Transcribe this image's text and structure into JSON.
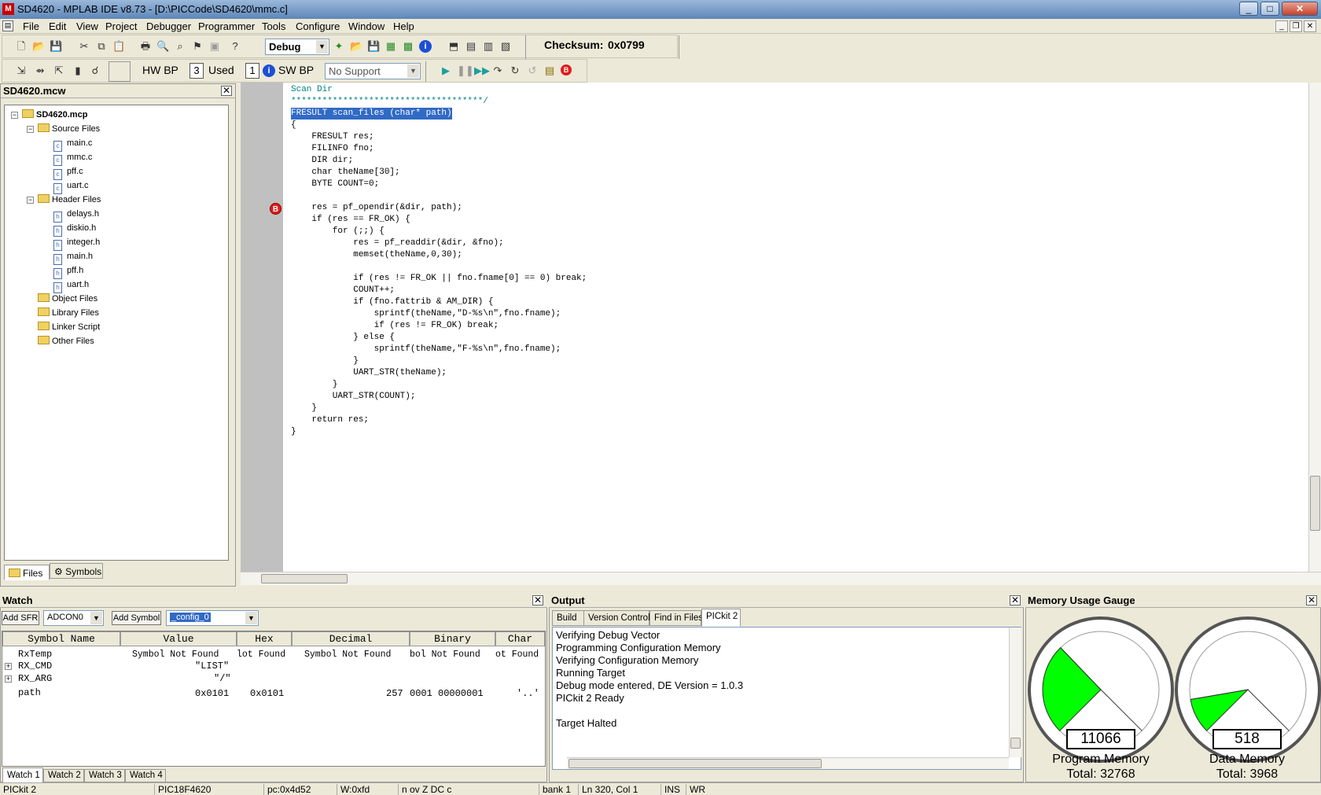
{
  "window": {
    "title": "SD4620 - MPLAB IDE v8.73 - [D:\\PICCode\\SD4620\\mmc.c]"
  },
  "menu": [
    "File",
    "Edit",
    "View",
    "Project",
    "Debugger",
    "Programmer",
    "Tools",
    "Configure",
    "Window",
    "Help"
  ],
  "toolbar": {
    "build_config": "Debug",
    "checksum_label": "Checksum:",
    "checksum_value": "0x0799",
    "hw_bp_label": "HW BP",
    "hw_bp_count": "3",
    "used_label": "Used",
    "used_count": "1",
    "sw_bp_label": "SW BP",
    "sw_bp_select": "No Support"
  },
  "project": {
    "title": "SD4620.mcw",
    "root": "SD4620.mcp",
    "folders": [
      {
        "name": "Source Files",
        "files": [
          "main.c",
          "mmc.c",
          "pff.c",
          "uart.c"
        ]
      },
      {
        "name": "Header Files",
        "files": [
          "delays.h",
          "diskio.h",
          "integer.h",
          "main.h",
          "pff.h",
          "uart.h"
        ]
      },
      {
        "name": "Object Files",
        "files": []
      },
      {
        "name": "Library Files",
        "files": []
      },
      {
        "name": "Linker Script",
        "files": []
      },
      {
        "name": "Other Files",
        "files": []
      }
    ],
    "tabs": [
      "Files",
      "Symbols"
    ]
  },
  "editor": {
    "lines": [
      "Scan Dir",
      "*************************************/",
      "FRESULT scan_files (char* path)",
      "{",
      "    FRESULT res;",
      "    FILINFO fno;",
      "    DIR dir;",
      "    char theName[30];",
      "    BYTE COUNT=0;",
      "",
      "    res = pf_opendir(&dir, path);",
      "    if (res == FR_OK) {",
      "        for (;;) {",
      "            res = pf_readdir(&dir, &fno);",
      "            memset(theName,0,30);",
      "",
      "            if (res != FR_OK || fno.fname[0] == 0) break;",
      "            COUNT++;",
      "            if (fno.fattrib & AM_DIR) {",
      "                sprintf(theName,\"D-%s\\n\",fno.fname);",
      "                if (res != FR_OK) break;",
      "            } else {",
      "                sprintf(theName,\"F-%s\\n\",fno.fname);",
      "            }",
      "            UART_STR(theName);",
      "        }",
      "        UART_STR(COUNT);",
      "    }",
      "    return res;",
      "}"
    ],
    "breakpoint_glyph": "B"
  },
  "watch": {
    "title": "Watch",
    "add_sfr": "Add SFR",
    "sfr_select": "ADCON0",
    "add_symbol": "Add Symbol",
    "symbol_select": "_config_0",
    "columns": [
      "Symbol Name",
      "Value",
      "Hex",
      "Decimal",
      "Binary",
      "Char"
    ],
    "rows": [
      {
        "name": "RxTemp",
        "value": "Symbol  Not  Found",
        "hex": "lot  Found",
        "decimal": "Symbol  Not  Found",
        "binary": "bol  Not  Found",
        "char": "ot  Found"
      },
      {
        "name": "RX_CMD",
        "value": "\"LIST\"",
        "hex": "",
        "decimal": "",
        "binary": "",
        "char": ""
      },
      {
        "name": "RX_ARG",
        "value": "\"/\"",
        "hex": "",
        "decimal": "",
        "binary": "",
        "char": ""
      },
      {
        "name": "path",
        "value": "0x0101",
        "hex": "0x0101",
        "decimal": "257",
        "binary": "0001  00000001",
        "char": "'..'"
      }
    ],
    "tabs": [
      "Watch 1",
      "Watch 2",
      "Watch 3",
      "Watch 4"
    ]
  },
  "output": {
    "title": "Output",
    "tabs": [
      "Build",
      "Version Control",
      "Find in Files",
      "PICkit 2"
    ],
    "lines": [
      "Verifying Debug Vector",
      "Programming Configuration Memory",
      "Verifying Configuration Memory",
      "Running Target",
      "Debug mode entered, DE Version = 1.0.3",
      "PICkit 2 Ready",
      "",
      "Target Halted"
    ]
  },
  "memory": {
    "title": "Memory Usage Gauge",
    "program": {
      "value": "11066",
      "label": "Program Memory",
      "total": "Total: 32768",
      "used": 11066,
      "max": 32768
    },
    "data": {
      "value": "518",
      "label": "Data Memory",
      "total": "Total: 3968",
      "used": 518,
      "max": 3968
    },
    "fill_color": "#00ff00"
  },
  "status": {
    "tool": "PICkit 2",
    "device": "PIC18F4620",
    "pc": "pc:0x4d52",
    "w": "W:0xfd",
    "flags": "n ov Z DC c",
    "bank": "bank 1",
    "pos": "Ln 320, Col 1",
    "ins": "INS",
    "wr": "WR"
  }
}
